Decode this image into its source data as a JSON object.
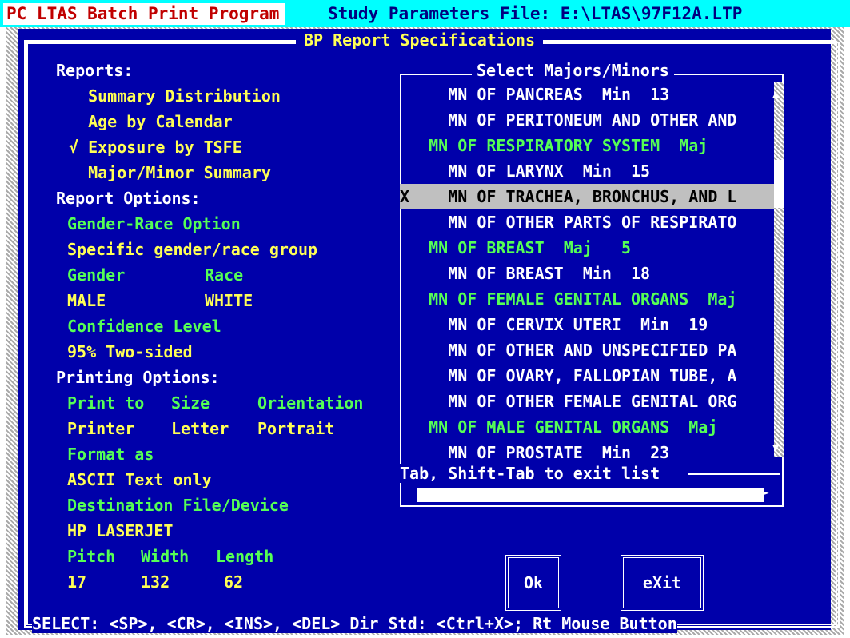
{
  "titlebar": {
    "app_title": "PC LTAS Batch Print Program",
    "study_file": "Study Parameters File: E:\\LTAS\\97F12A.LTP"
  },
  "panel": {
    "title": "BP Report Specifications"
  },
  "left": {
    "reports_heading": "Reports:",
    "reports": [
      "  Summary Distribution",
      "  Age by Calendar",
      "√ Exposure by TSFE",
      "  Major/Minor Summary"
    ],
    "report_options_heading": "Report Options:",
    "gender_race_option_label": "Gender-Race Option",
    "gender_race_option_value": "Specific gender/race group",
    "gender_label": "Gender",
    "race_label": "Race",
    "gender_value": "MALE",
    "race_value": "WHITE",
    "confidence_label": "Confidence Level",
    "confidence_value": "95% Two-sided",
    "printing_heading": "Printing Options:",
    "print_to_label": "Print to",
    "size_label": "Size",
    "orientation_label": "Orientation",
    "print_to_value": "Printer",
    "size_value": "Letter",
    "orientation_value": "Portrait",
    "format_label": "Format as",
    "format_value": "ASCII Text only",
    "destination_label": "Destination File/Device",
    "destination_value": "HP LASERJET",
    "pitch_label": "Pitch",
    "width_label": "Width",
    "length_label": "Length",
    "pitch_value": "17",
    "width_value": "132",
    "length_value": "62"
  },
  "list": {
    "title": "Select Majors/Minors",
    "items": [
      {
        "text": "     MN OF PANCREAS  Min  13",
        "kind": "minor"
      },
      {
        "text": "     MN OF PERITONEUM AND OTHER AND",
        "kind": "minor"
      },
      {
        "text": "   MN OF RESPIRATORY SYSTEM  Maj",
        "kind": "major"
      },
      {
        "text": "     MN OF LARYNX  Min  15",
        "kind": "minor"
      },
      {
        "text": "X    MN OF TRACHEA, BRONCHUS, AND L",
        "kind": "selected"
      },
      {
        "text": "     MN OF OTHER PARTS OF RESPIRATO",
        "kind": "minor"
      },
      {
        "text": "   MN OF BREAST  Maj   5",
        "kind": "major"
      },
      {
        "text": "     MN OF BREAST  Min  18",
        "kind": "minor"
      },
      {
        "text": "   MN OF FEMALE GENITAL ORGANS  Maj",
        "kind": "major"
      },
      {
        "text": "     MN OF CERVIX UTERI  Min  19",
        "kind": "minor"
      },
      {
        "text": "     MN OF OTHER AND UNSPECIFIED PA",
        "kind": "minor"
      },
      {
        "text": "     MN OF OVARY, FALLOPIAN TUBE, A",
        "kind": "minor"
      },
      {
        "text": "     MN OF OTHER FEMALE GENITAL ORG",
        "kind": "minor"
      },
      {
        "text": "   MN OF MALE GENITAL ORGANS  Maj",
        "kind": "major"
      },
      {
        "text": "     MN OF PROSTATE  Min  23",
        "kind": "minor"
      }
    ],
    "exit_hint": "Tab, Shift-Tab to exit list"
  },
  "buttons": {
    "ok": "Ok",
    "exit": "eXit"
  },
  "status_line": "SELECT: <SP>, <CR>, <INS>, <DEL>  Dir Std: <Ctrl+X>; Rt Mouse Button",
  "colors": {
    "background": "#0000aa",
    "heading": "#ffffff",
    "value": "#ffff55",
    "label": "#55ff55",
    "selection": "#c0c0c0"
  }
}
